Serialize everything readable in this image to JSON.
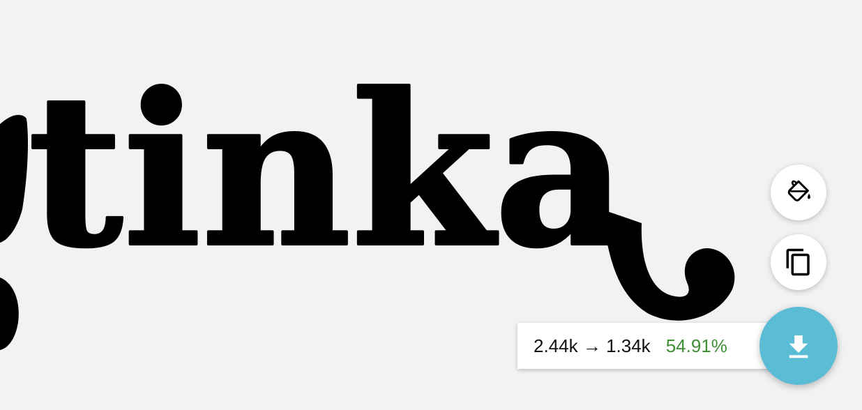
{
  "artwork": {
    "visible_text": "tinka"
  },
  "toolbar": {
    "fill_button_icon": "paint-bucket-icon",
    "copy_button_icon": "copy-icon",
    "download_button_icon": "download-icon",
    "download_color": "#5bbcd5"
  },
  "result": {
    "original_size": "2.44k",
    "arrow": "→",
    "optimized_size": "1.34k",
    "saving": "54.91%",
    "saving_color": "#3f8f35"
  }
}
